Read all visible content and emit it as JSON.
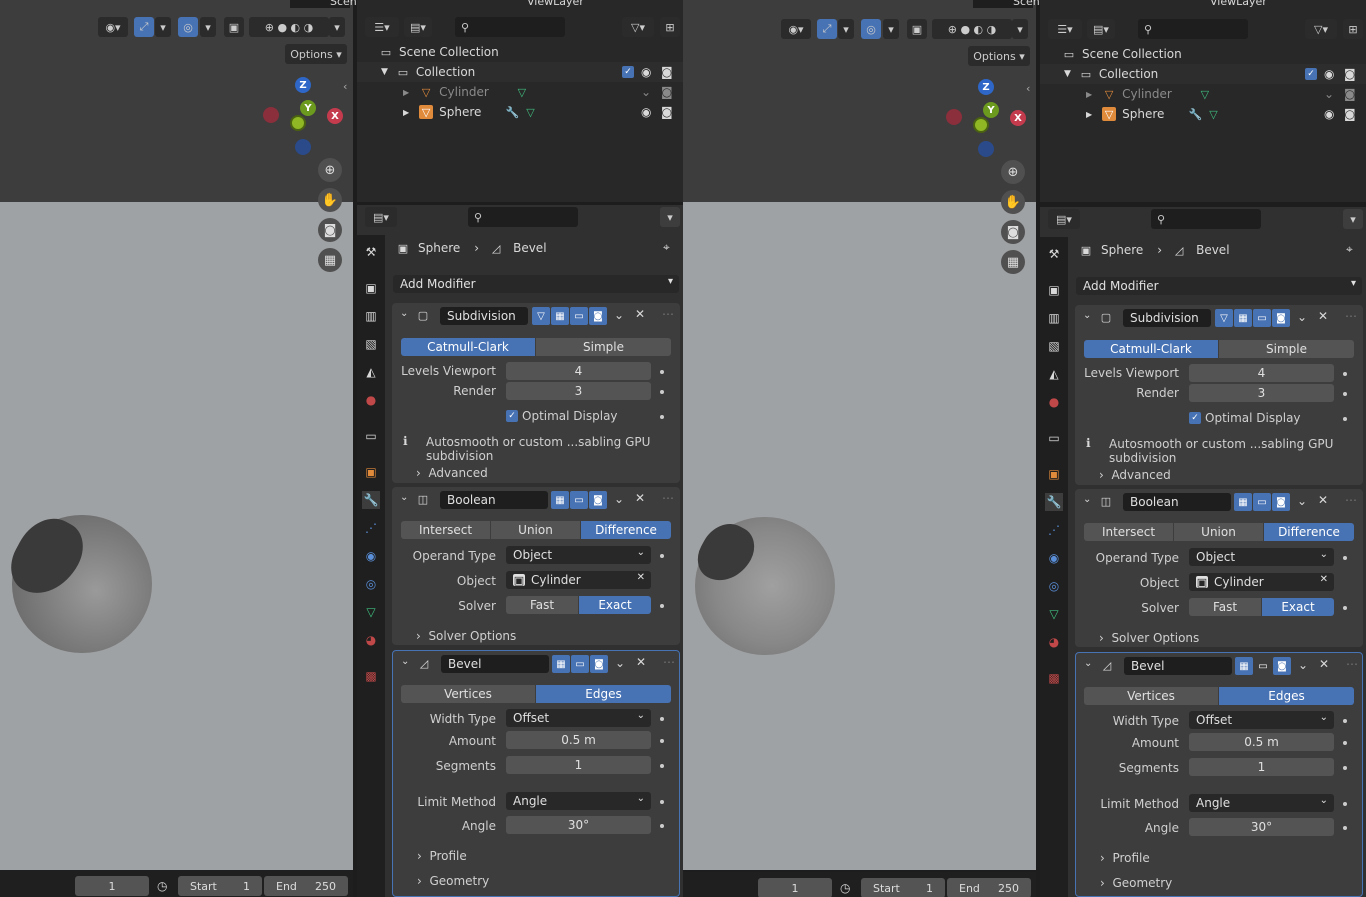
{
  "header": {
    "scene_label": "Scene",
    "viewlayer_label": "ViewLayer"
  },
  "viewport": {
    "options_label": "Options",
    "axis_z": "Z",
    "axis_y": "Y",
    "axis_x": "X"
  },
  "outliner": {
    "scene_collection": "Scene Collection",
    "collection": "Collection",
    "objects": [
      "Cylinder",
      "Sphere"
    ]
  },
  "properties": {
    "breadcrumb_object": "Sphere",
    "breadcrumb_modifier": "Bevel",
    "add_modifier": "Add Modifier",
    "subdivision": {
      "name": "Subdivision",
      "mode_a": "Catmull-Clark",
      "mode_b": "Simple",
      "levels_label": "Levels Viewport",
      "levels_value": "4",
      "render_label": "Render",
      "render_value": "3",
      "optimal_label": "Optimal Display",
      "info": "Autosmooth or custom ...sabling GPU subdivision",
      "advanced": "Advanced"
    },
    "boolean": {
      "name": "Boolean",
      "op_a": "Intersect",
      "op_b": "Union",
      "op_c": "Difference",
      "operand_label": "Operand Type",
      "operand_value": "Object",
      "object_label": "Object",
      "object_value": "Cylinder",
      "solver_label": "Solver",
      "solver_a": "Fast",
      "solver_b": "Exact",
      "solver_options": "Solver Options"
    },
    "bevel": {
      "name": "Bevel",
      "mode_a": "Vertices",
      "mode_b": "Edges",
      "width_label": "Width Type",
      "width_value": "Offset",
      "amount_label": "Amount",
      "amount_value": "0.5 m",
      "segments_label": "Segments",
      "segments_value": "1",
      "limit_label": "Limit Method",
      "limit_value": "Angle",
      "angle_label": "Angle",
      "angle_value": "30°",
      "profile": "Profile",
      "geometry": "Geometry"
    }
  },
  "timeline": {
    "frame": "1",
    "start_label": "Start",
    "start_value": "1",
    "end_label": "End",
    "end_value": "250"
  }
}
